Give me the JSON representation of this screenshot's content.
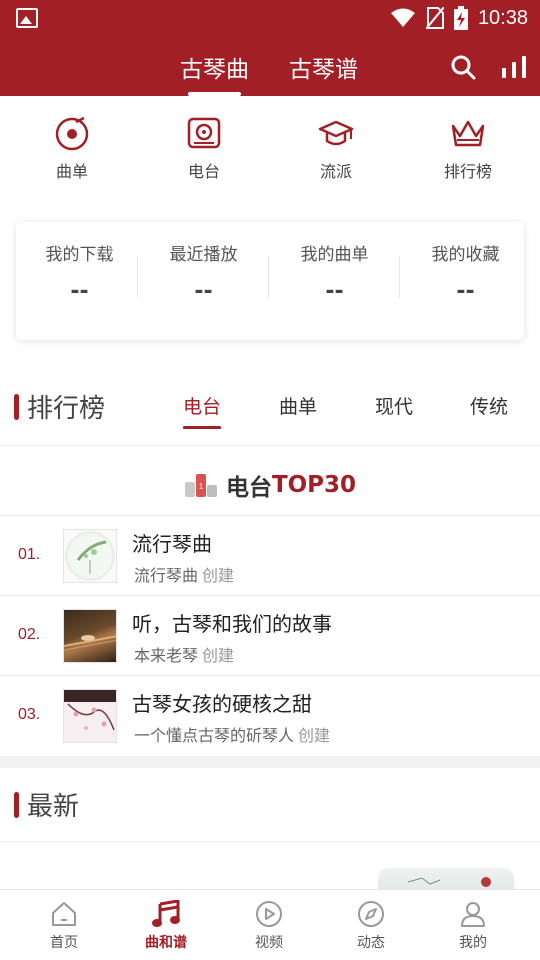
{
  "status_bar": {
    "time": "10:38"
  },
  "header": {
    "tabs": [
      "古琴曲",
      "古琴谱"
    ],
    "active_tab": "古琴曲"
  },
  "quick_nav": [
    {
      "label": "曲单",
      "icon": "vinyl-icon"
    },
    {
      "label": "电台",
      "icon": "radio-icon"
    },
    {
      "label": "流派",
      "icon": "graduation-cap-icon"
    },
    {
      "label": "排行榜",
      "icon": "crown-icon"
    }
  ],
  "my_stats": [
    {
      "label": "我的下载",
      "value": "--"
    },
    {
      "label": "最近播放",
      "value": "--"
    },
    {
      "label": "我的曲单",
      "value": "--"
    },
    {
      "label": "我的收藏",
      "value": "--"
    }
  ],
  "ranking": {
    "title": "排行榜",
    "tabs": [
      "电台",
      "曲单",
      "现代",
      "传统"
    ],
    "active_tab": "电台",
    "banner_prefix": "电台",
    "banner_suffix": "TOP30",
    "items": [
      {
        "rank": "01.",
        "name": "流行琴曲",
        "creator": "流行琴曲",
        "suffix": "创建"
      },
      {
        "rank": "02.",
        "name": "听，古琴和我们的故事",
        "creator": "本来老琴",
        "suffix": "创建"
      },
      {
        "rank": "03.",
        "name": "古琴女孩的硬核之甜",
        "creator": "一个懂点古琴的斫琴人",
        "suffix": "创建"
      }
    ]
  },
  "latest": {
    "title": "最新"
  },
  "bottom_nav": [
    {
      "label": "首页",
      "icon": "home-icon"
    },
    {
      "label": "曲和谱",
      "icon": "music-note-icon"
    },
    {
      "label": "视频",
      "icon": "video-play-icon"
    },
    {
      "label": "动态",
      "icon": "compass-icon"
    },
    {
      "label": "我的",
      "icon": "user-icon"
    }
  ],
  "accent_color": "#a31f26"
}
